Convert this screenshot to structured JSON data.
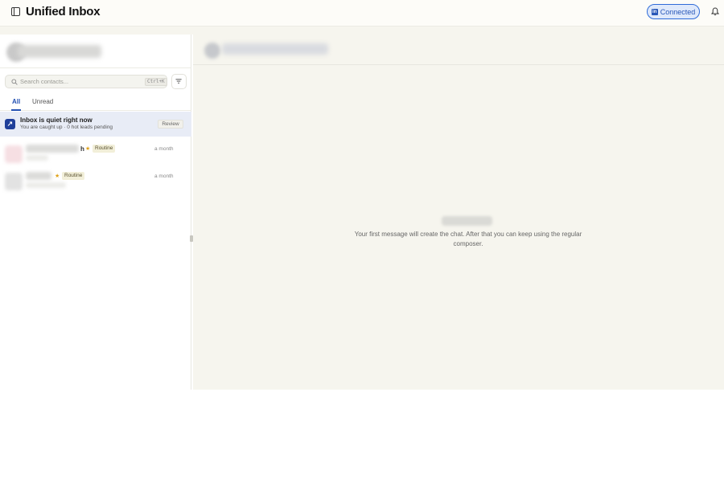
{
  "header": {
    "title": "Unified Inbox",
    "connection_status": "Connected",
    "connection_icon": "in"
  },
  "sidebar": {
    "search": {
      "placeholder": "Search contacts...",
      "value": "",
      "shortcut": "Ctrl+K"
    },
    "tabs": [
      {
        "label": "All",
        "active": true
      },
      {
        "label": "Unread",
        "active": false
      }
    ],
    "notice": {
      "title": "Inbox is quiet right now",
      "subtitle": "You are caught up · 0 hot leads pending",
      "action_label": "Review"
    },
    "contacts": [
      {
        "name_suffix": "h",
        "starred": true,
        "badge": "Routine",
        "time": "a month"
      },
      {
        "name_suffix": "",
        "starred": true,
        "badge": "Routine",
        "time": "a month"
      }
    ]
  },
  "main": {
    "empty_message": "Your first message will create the chat. After that you can keep using the regular composer."
  },
  "colors": {
    "accent": "#2451b3",
    "connected_bg": "#dfe9fb",
    "star": "#e0a21a",
    "selected_row": "#e8ecf6",
    "pane_bg": "#f6f5ee"
  }
}
